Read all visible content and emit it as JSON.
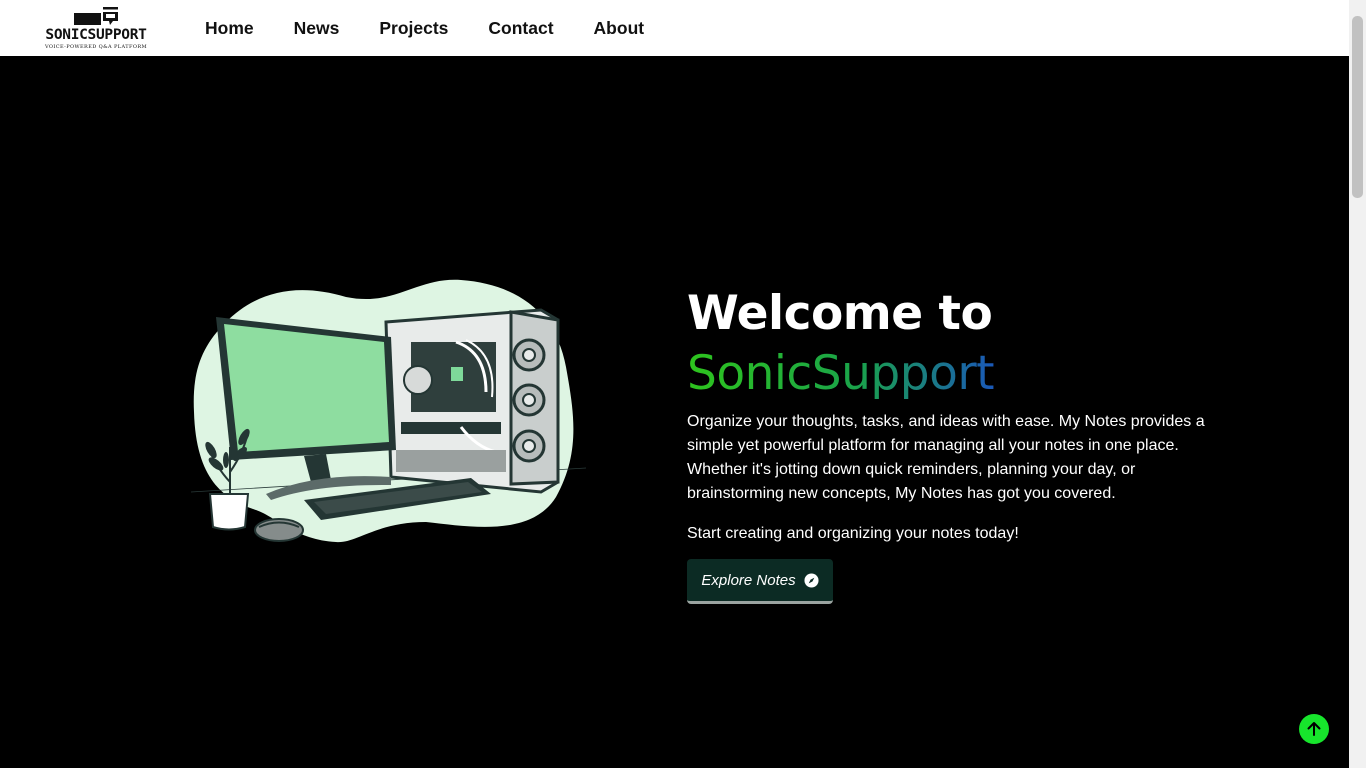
{
  "logo": {
    "name": "SONICSUPPORT",
    "tagline": "VOICE-POWERED Q&A PLATFORM"
  },
  "nav": {
    "items": [
      {
        "label": "Home"
      },
      {
        "label": "News"
      },
      {
        "label": "Projects"
      },
      {
        "label": "Contact"
      },
      {
        "label": "About"
      }
    ]
  },
  "hero": {
    "title_line1": "Welcome to",
    "brand": "SonicSupport",
    "description": "Organize your thoughts, tasks, and ideas with ease. My Notes provides a simple yet powerful platform for managing all your notes in one place. Whether it's jotting down quick reminders, planning your day, or brainstorming new concepts, My Notes has got you covered.",
    "cta_text": "Start creating and organizing your notes today!",
    "button_label": "Explore Notes",
    "button_icon": "compass-icon",
    "illustration": "desktop-computer-illustration"
  },
  "scroll_top": {
    "icon": "arrow-up-icon"
  },
  "colors": {
    "page_bg": "#000000",
    "navbar_bg": "#ffffff",
    "button_bg": "#0c2b24",
    "scroll_top_bg": "#17e52c",
    "brand_gradient_start": "#2ec41d",
    "brand_gradient_end": "#1a58b8"
  }
}
